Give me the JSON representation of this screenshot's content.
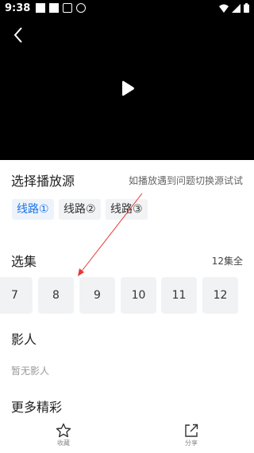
{
  "status_bar": {
    "time": "9:38"
  },
  "source": {
    "title": "选择播放源",
    "hint": "如播放遇到问题切换源试试",
    "lines": [
      {
        "label": "线路①"
      },
      {
        "label": "线路②"
      },
      {
        "label": "线路③"
      }
    ]
  },
  "episodes": {
    "title": "选集",
    "count_label": "12集全",
    "items": [
      {
        "label": "7"
      },
      {
        "label": "8"
      },
      {
        "label": "9"
      },
      {
        "label": "10"
      },
      {
        "label": "11"
      },
      {
        "label": "12"
      }
    ]
  },
  "cast": {
    "title": "影人",
    "empty_text": "暂无影人"
  },
  "more": {
    "title": "更多精彩"
  },
  "bottom_bar": {
    "favorite_label": "收藏",
    "share_label": "分享"
  },
  "colors": {
    "accent": "#1a73e8",
    "annotation": "#e53935"
  },
  "icons": [
    "back-icon",
    "play-icon",
    "star-icon",
    "share-icon",
    "wifi-icon",
    "signal-icon",
    "battery-icon"
  ]
}
